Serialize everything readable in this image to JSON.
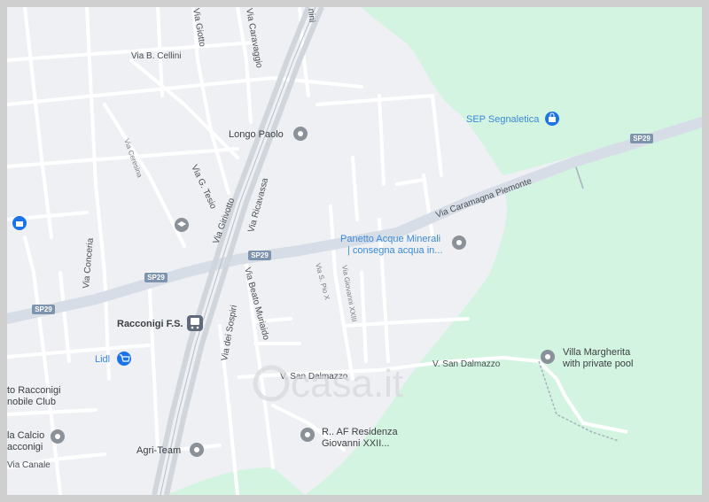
{
  "map": {
    "watermark": "casa.it",
    "road_shields": [
      "SP29",
      "SP29",
      "SP29",
      "SP29"
    ],
    "streets": [
      "Via B. Cellini",
      "Via Giotto",
      "Via Caravaggio",
      "Via G. Tesio",
      "Via Girivotto",
      "Via Ricavassa",
      "Via Conceria",
      "Via Caramagna Piemonte",
      "Via dei Sospiri",
      "Via Beato Muriaido",
      "Via S. Pio X",
      "Via Giovanni XXIII",
      "V. San Dalmazzo",
      "V. San Dalmazzo",
      "Via Canale",
      "Via Ceresina",
      "nini"
    ],
    "pois": {
      "sep": "SEP Segnaletica",
      "longo": "Longo Paolo",
      "panetto_1": "Panetto Acque Minerali",
      "panetto_2": "| consegna acqua in...",
      "station": "Racconigi F.S.",
      "lidl": "Lidl",
      "villa_1": "Villa Margherita",
      "villa_2": "with private pool",
      "moto_1": "to Racconigi",
      "moto_2": "nobile Club",
      "calcio_1": "la Calcio",
      "calcio_2": "acconigi",
      "agri": "Agri-Team",
      "raf_1": "R.. AF Residenza",
      "raf_2": "Giovanni XXII..."
    },
    "icons": {
      "pin": "location-pin-icon",
      "shop": "shopping-bag-icon",
      "cart": "shopping-cart-icon",
      "train": "train-icon",
      "school": "school-icon"
    },
    "colors": {
      "land": "#eef0f3",
      "park": "#d3f4e0",
      "road": "#ffffff",
      "highway": "#d6dde6",
      "shield": "#7e93ad",
      "poi_blue": "#1a73e8",
      "poi_gray": "#8a9199"
    }
  }
}
